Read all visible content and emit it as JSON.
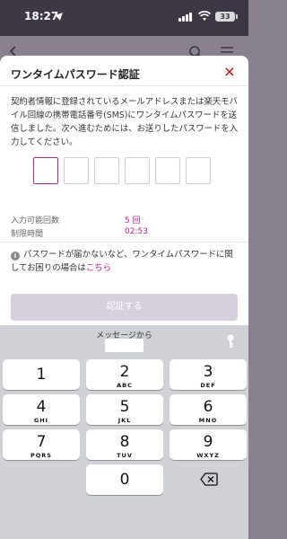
{
  "status_bar": {
    "time": "18:27",
    "battery": "33"
  },
  "modal": {
    "title": "ワンタイムパスワード認証",
    "close_glyph": "×",
    "description": "契約者情報に登録されているメールアドレスまたは楽天モバイル回線の携帯電話番号(SMS)にワンタイムパスワードを送信しました。次へ進むためには、お送りしたパスワードを入力してください。",
    "attempts_label": "入力可能回数",
    "attempts_value": "5 回",
    "time_label": "制限時間",
    "time_value": "02:53",
    "notice_text": "パスワードが届かないなど、ワンタイムパスワードに関してお困りの場合は",
    "notice_link": "こちら",
    "submit_label": "認証する"
  },
  "keyboard": {
    "suggestion_title": "メッセージから",
    "keys": [
      {
        "num": "1",
        "letters": ""
      },
      {
        "num": "2",
        "letters": "ABC"
      },
      {
        "num": "3",
        "letters": "DEF"
      },
      {
        "num": "4",
        "letters": "GHI"
      },
      {
        "num": "5",
        "letters": "JKL"
      },
      {
        "num": "6",
        "letters": "MNO"
      },
      {
        "num": "7",
        "letters": "PQRS"
      },
      {
        "num": "8",
        "letters": "TUV"
      },
      {
        "num": "9",
        "letters": "WXYZ"
      },
      {
        "num": "0",
        "letters": ""
      }
    ]
  },
  "colors": {
    "accent": "#b1218e",
    "close": "#bf0000",
    "button_disabled": "#d6cfde",
    "keyboard_bg": "#cfd1d6"
  },
  "icons": [
    "location-arrow-icon",
    "signal-icon",
    "wifi-icon",
    "battery-icon",
    "back-arrow-icon",
    "search-icon",
    "menu-icon",
    "close-icon",
    "info-icon",
    "key-icon",
    "delete-icon"
  ]
}
